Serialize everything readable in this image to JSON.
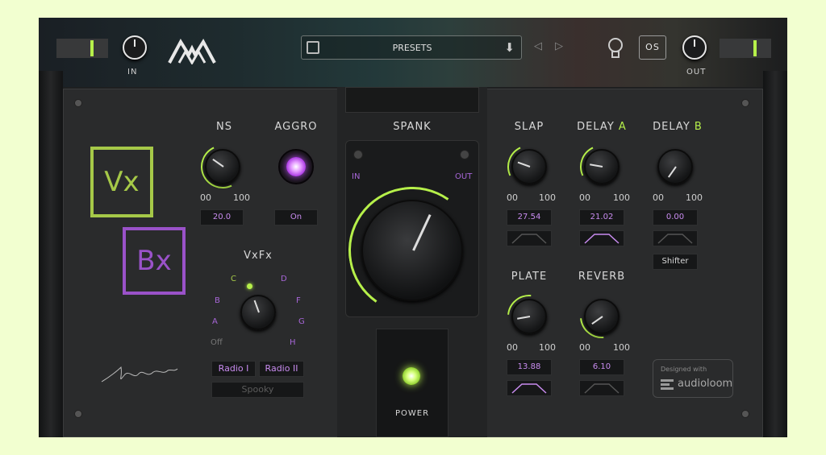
{
  "header": {
    "input_label": "IN",
    "output_label": "OUT",
    "presets_label": "PRESETS",
    "os_label": "OS"
  },
  "logo": {
    "vx": "Vx",
    "bx": "Bx"
  },
  "ns": {
    "title": "NS",
    "min": "00",
    "max": "100",
    "value": "20.0"
  },
  "aggro": {
    "title": "AGGRO",
    "value": "On"
  },
  "vxfx": {
    "title": "VxFx",
    "positions": [
      "Off",
      "A",
      "B",
      "C",
      "D",
      "F",
      "G",
      "H"
    ],
    "buttons": [
      "Radio I",
      "Radio II",
      "Spooky"
    ]
  },
  "spank": {
    "title": "SPANK",
    "in_label": "IN",
    "out_label": "OUT",
    "power_label": "POWER"
  },
  "slap": {
    "title": "SLAP",
    "min": "00",
    "max": "100",
    "value": "27.54"
  },
  "delay_a": {
    "title": "DELAY",
    "suffix": "A",
    "min": "00",
    "max": "100",
    "value": "21.02"
  },
  "delay_b": {
    "title": "DELAY",
    "suffix": "B",
    "min": "00",
    "max": "100",
    "value": "0.00",
    "shifter": "Shifter"
  },
  "plate": {
    "title": "PLATE",
    "min": "00",
    "max": "100",
    "value": "13.88"
  },
  "reverb": {
    "title": "REVERB",
    "min": "00",
    "max": "100",
    "value": "6.10"
  },
  "credit": {
    "designed_with": "Designed with",
    "brand": "audioloom"
  },
  "colors": {
    "accent_green": "#b6f04a",
    "accent_purple": "#a766d8",
    "value_text": "#c98cf0"
  }
}
